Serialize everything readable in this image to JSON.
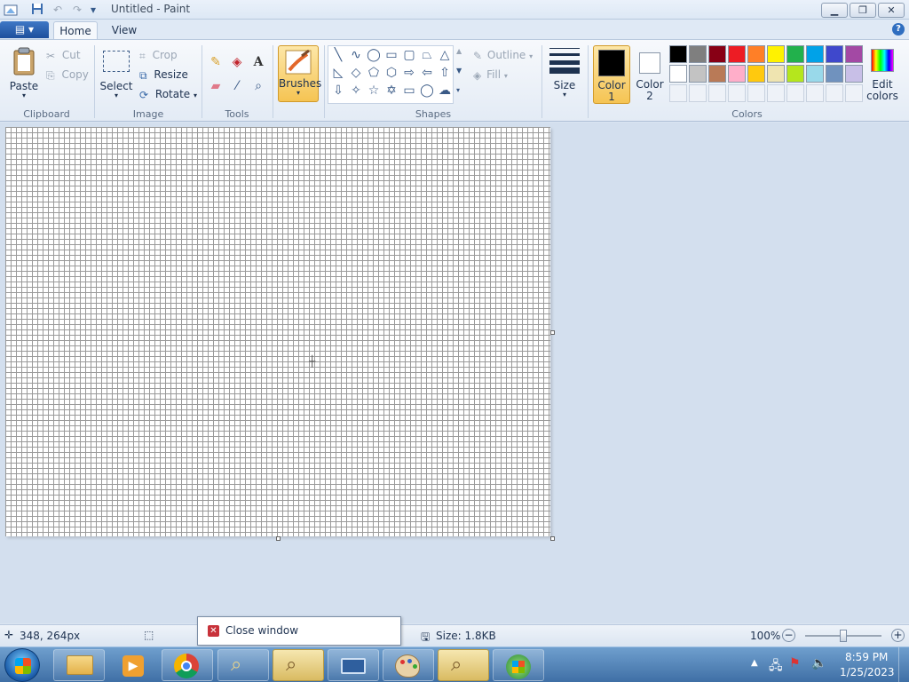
{
  "window": {
    "title": "Untitled - Paint",
    "minimize": "▁",
    "restore": "❐",
    "close": "✕"
  },
  "quick_access": {
    "customize": "▾"
  },
  "tabs": [
    {
      "label": "Home"
    },
    {
      "label": "View"
    }
  ],
  "help": "?",
  "clipboard": {
    "group_label": "Clipboard",
    "paste": "Paste",
    "cut": "Cut",
    "copy": "Copy"
  },
  "image": {
    "group_label": "Image",
    "select": "Select",
    "crop": "Crop",
    "resize": "Resize",
    "rotate": "Rotate"
  },
  "tools": {
    "group_label": "Tools",
    "text_tool": "A"
  },
  "brushes": {
    "label": "Brushes"
  },
  "shapes": {
    "group_label": "Shapes",
    "outline": "Outline",
    "fill": "Fill"
  },
  "size": {
    "label": "Size"
  },
  "colors": {
    "group_label": "Colors",
    "color1_line1": "Color",
    "color1_line2": "1",
    "color2_line1": "Color",
    "color2_line2": "2",
    "edit_line1": "Edit",
    "edit_line2": "colors",
    "color1_value": "#000000",
    "color2_value": "#ffffff",
    "palette_row1": [
      "#000000",
      "#7f7f7f",
      "#880015",
      "#ed1c24",
      "#ff7f27",
      "#fff200",
      "#22b14c",
      "#00a2e8",
      "#3f48cc",
      "#a349a4"
    ],
    "palette_row2": [
      "#ffffff",
      "#c3c3c3",
      "#b97a57",
      "#ffaec9",
      "#ffc90e",
      "#efe4b0",
      "#b5e61d",
      "#99d9ea",
      "#7092be",
      "#c8bfe7"
    ]
  },
  "status": {
    "coords": "348, 264px",
    "popup": "Close window",
    "size": "Size: 1.8KB",
    "zoom": "100%"
  },
  "taskbar": {
    "time": "8:59 PM",
    "date": "1/25/2023"
  }
}
